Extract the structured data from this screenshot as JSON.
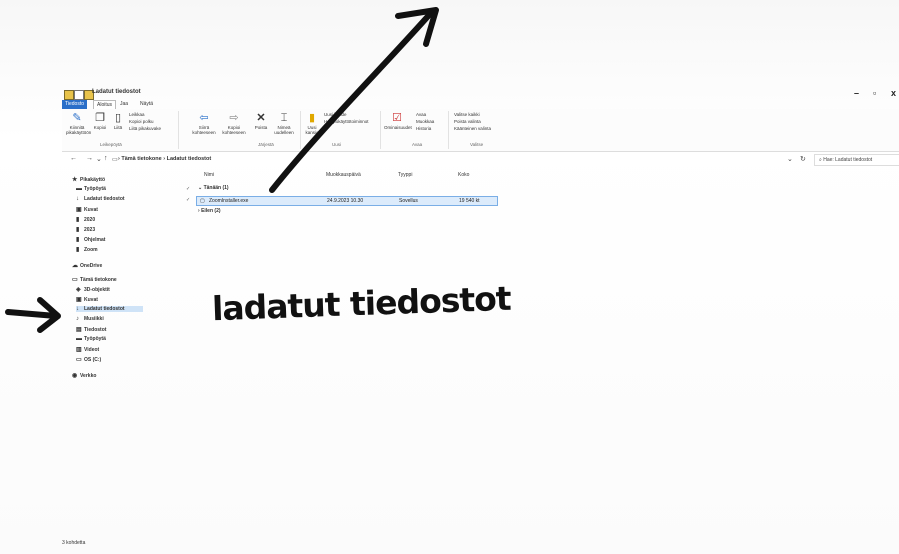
{
  "window": {
    "title": "Ladatut tiedostot",
    "controls": {
      "minimize": "–",
      "maximize": "▫",
      "close": "x"
    }
  },
  "tabs": [
    {
      "label": "Tiedosto"
    },
    {
      "label": "Aloitus"
    },
    {
      "label": "Jaa"
    },
    {
      "label": "Näytä"
    }
  ],
  "ribbon": {
    "clipboard": {
      "pin": "Kiinnitä pikakäyttöön",
      "copy": "Kopioi",
      "paste": "Liitä",
      "cut": "Leikkaa",
      "copy_path": "Kopioi polku",
      "paste_shortcut": "Liitä pikakuvake",
      "label": "Leikepöytä"
    },
    "organize": {
      "move_to": "Siirrä kohteeseen",
      "copy_to": "Kopioi kohteeseen",
      "delete": "Poista",
      "rename": "Nimeä uudelleen",
      "label": "Järjestä"
    },
    "new": {
      "new_folder": "Uusi kansio",
      "new_item": "Uusi kohde",
      "easy_access": "Helppokäyttötoiminnot",
      "label": "Uusi"
    },
    "open": {
      "properties": "Ominaisuudet",
      "open": "Avaa",
      "edit": "Muokkaa",
      "history": "Historia",
      "label": "Avaa"
    },
    "select": {
      "select_all": "Valitse kaikki",
      "select_none": "Poista valinta",
      "invert": "Käänteinen valinta",
      "label": "Valitse"
    }
  },
  "address": {
    "breadcrumb": "› Tämä tietokone › Ladatut tiedostot",
    "search_placeholder": "Hae: Ladatut tiedostot"
  },
  "sidebar": {
    "items": [
      {
        "label": "Pikakäyttö",
        "icon": "★"
      },
      {
        "label": "Työpöytä",
        "icon": "▬"
      },
      {
        "label": "Ladatut tiedostot",
        "icon": "↓"
      },
      {
        "label": "Kuvat",
        "icon": "▣"
      },
      {
        "label": "2020",
        "icon": "▮"
      },
      {
        "label": "2023",
        "icon": "▮"
      },
      {
        "label": "Ohjelmat",
        "icon": "▮"
      },
      {
        "label": "Zoom",
        "icon": "▮"
      },
      {
        "label": "OneDrive",
        "icon": "☁"
      },
      {
        "label": "Tämä tietokone",
        "icon": "▭"
      },
      {
        "label": "3D-objektit",
        "icon": "◈"
      },
      {
        "label": "Kuvat",
        "icon": "▣"
      },
      {
        "label": "Ladatut tiedostot",
        "icon": "↓"
      },
      {
        "label": "Musiikki",
        "icon": "♪"
      },
      {
        "label": "Tiedostot",
        "icon": "▤"
      },
      {
        "label": "Työpöytä",
        "icon": "▬"
      },
      {
        "label": "Videot",
        "icon": "▥"
      },
      {
        "label": "OS (C:)",
        "icon": "▭"
      },
      {
        "label": "Verkko",
        "icon": "◉"
      }
    ]
  },
  "list": {
    "columns": {
      "name": "Nimi",
      "modified": "Muokkauspäivä",
      "type": "Tyyppi",
      "size": "Koko"
    },
    "groups": [
      {
        "label": "Tänään (1)"
      },
      {
        "label": "Eilen (2)"
      }
    ],
    "rows": [
      {
        "name": "ZoomInstaller.exe",
        "modified": "24.9.2023 10.30",
        "type": "Sovellus",
        "size": "19 540 kt"
      }
    ]
  },
  "status": {
    "text": "3 kohdetta"
  },
  "annotations": {
    "handwritten_label": "ladatut tiedostot",
    "side_arrow": "->"
  }
}
